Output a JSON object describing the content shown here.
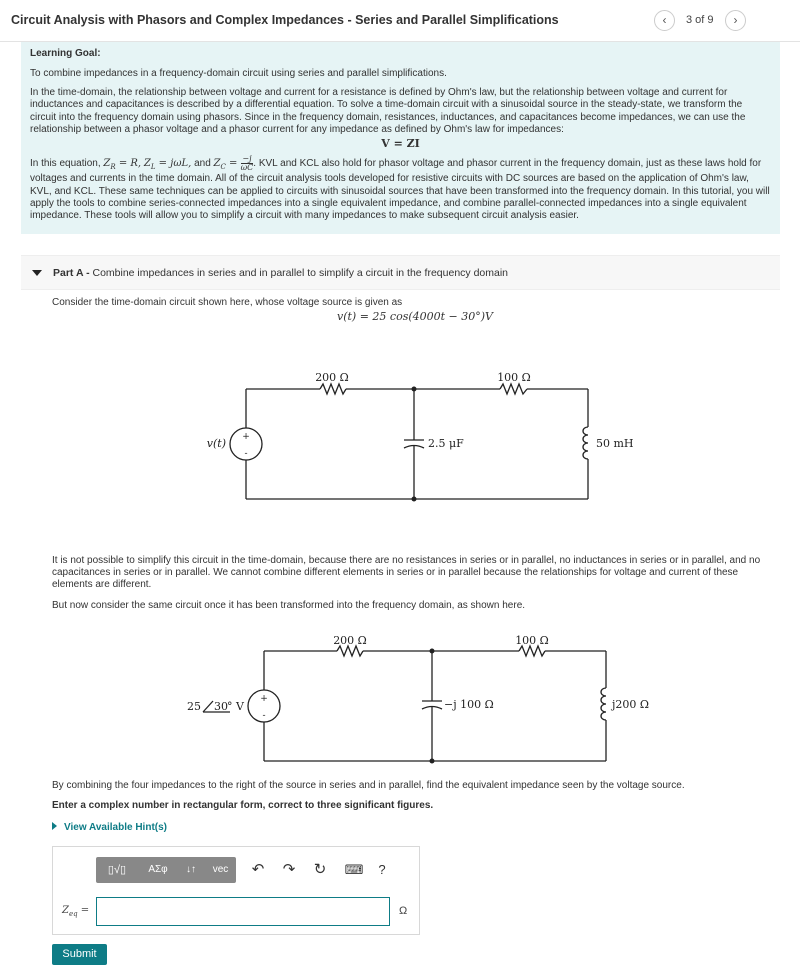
{
  "header": {
    "title": "Circuit Analysis with Phasors and Complex Impedances - Series and Parallel Simplifications",
    "prev_icon": "‹",
    "next_icon": "›",
    "page_count": "3 of 9"
  },
  "learning_goal": {
    "heading": "Learning Goal:",
    "intro": "To combine impedances in a frequency-domain circuit using series and parallel simplifications.",
    "para1": "In the time-domain, the relationship between voltage and current for a resistance is defined by Ohm's law, but the relationship between voltage and current for inductances and capacitances is described by a differential equation. To solve a time-domain circuit with a sinusoidal source in the steady-state, we transform the circuit into the frequency domain using phasors. Since in the frequency domain, resistances, inductances, and capacitances become impedances, we can use the relationship between a phasor voltage and a phasor current for any impedance as defined by Ohm's law for impedances:",
    "ohms_law": "V = ZI",
    "para2_prefix": "In this equation,",
    "zr": "Z",
    "zr_sub": "R",
    "zr_val": "= R,",
    "zl": "Z",
    "zl_sub": "L",
    "zl_val": "= jωL,",
    "and": "and",
    "zc": "Z",
    "zc_sub": "C",
    "zc_eq": "=",
    "zc_num": "−j",
    "zc_den": "ωC",
    "para2_rest": ". KVL and KCL also hold for phasor voltage and phasor current in the frequency domain, just as these laws hold for voltages and currents in the time domain. All of the circuit analysis tools developed for resistive circuits with DC sources are based on the application of Ohm's law, KVL, and KCL. These same techniques can be applied to circuits with sinusoidal sources that have been transformed into the frequency domain. In this tutorial, you will apply the tools to combine series-connected impedances into a single equivalent impedance, and combine parallel-connected impedances into a single equivalent impedance. These tools will allow you to simplify a circuit with many impedances to make subsequent circuit analysis easier."
  },
  "part_a": {
    "label": "Part A -",
    "title": "Combine impedances in series and in parallel to simplify a circuit in the frequency domain",
    "consider_text": "Consider the time-domain circuit shown here, whose voltage source is given as",
    "source_eq": "v(t) = 25 cos(4000t − 30°)V",
    "not_possible_text": "It is not possible to simplify this circuit in the time-domain, because there are no resistances in series or in parallel, no inductances in series or in parallel, and no capacitances in series or in parallel. We cannot combine different elements in series or in parallel because the relationships for voltage and current of these elements are different.",
    "but_now_text": "But now consider the same circuit once it has been transformed into the frequency domain, as shown here.",
    "question_text": "By combining the four impedances to the right of the source in series and in parallel, find the equivalent impedance seen by the voltage source.",
    "instruction_text": "Enter a complex number in rectangular form, correct to three significant figures.",
    "hint_label": "View Available Hint(s)"
  },
  "circuit_time": {
    "r1": "200 Ω",
    "r2": "100 Ω",
    "source": "v(t)",
    "plus": "+",
    "minus": "-",
    "cap": "2.5 μF",
    "ind": "50 mH"
  },
  "circuit_freq": {
    "r1": "200 Ω",
    "r2": "100 Ω",
    "source_mag": "25",
    "source_angle": "30",
    "source_unit": "° V",
    "plus": "+",
    "minus": "-",
    "cap": "−j 100 Ω",
    "ind": "j200 Ω"
  },
  "answer": {
    "label": "Z",
    "label_sub": "eq",
    "equals": "=",
    "value": "",
    "unit": "Ω",
    "toolbar": {
      "templates": "▯√▯",
      "symbols": "ΑΣφ",
      "arrows": "↓↑",
      "vec": "vec",
      "undo_icon": "↶",
      "redo_icon": "↷",
      "reset_icon": "↻",
      "keyboard_icon": "⌨",
      "help_icon": "?"
    }
  },
  "submit_label": "Submit",
  "colors": {
    "teal": "#0e7c86",
    "goal_bg": "#e6f4f5"
  }
}
